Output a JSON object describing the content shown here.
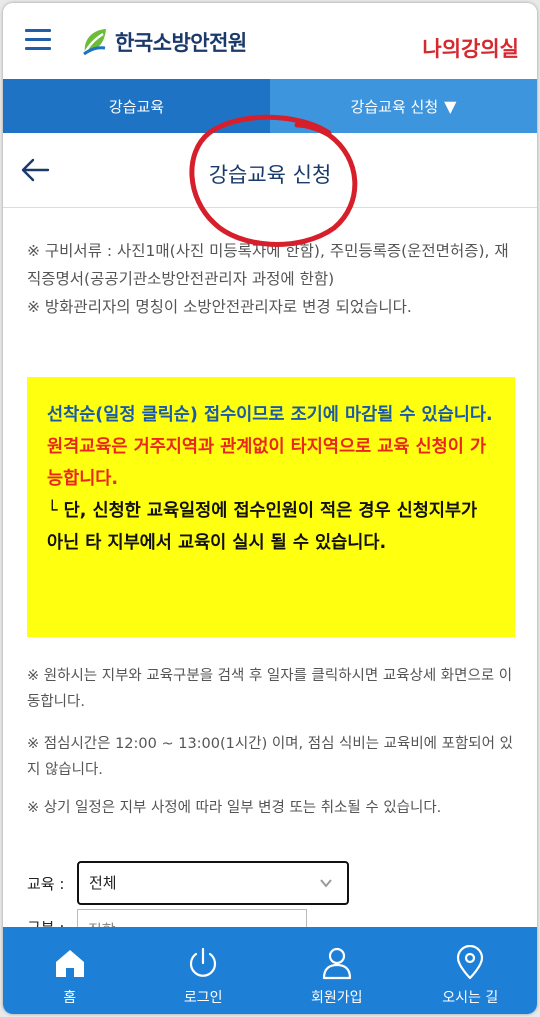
{
  "header": {
    "logo_text": "한국소방안전원",
    "my_class_label": "나의강의실"
  },
  "tabs": [
    {
      "label": "강습교육"
    },
    {
      "label": "강습교육 신청",
      "caret": "▼"
    }
  ],
  "page": {
    "title": "강습교육 신청"
  },
  "notices": {
    "documents": "※ 구비서류 : 사진1매(사진 미등록자에 한함), 주민등록증(운전면허증), 재직증명서(공공기관소방안전관리자 과정에 한함)",
    "rename": "※ 방화관리자의 명칭이 소방안전관리자로 변경 되었습니다.",
    "search_hint": "※ 원하시는 지부와 교육구분을 검색 후 일자를 클릭하시면 교육상세 화면으로 이동합니다.",
    "lunch": "※ 점심시간은 12:00 ~ 13:00(1시간) 이며, 점심 식비는 교육비에 포함되어 있지 않습니다.",
    "schedule_change": "※ 상기 일정은 지부 사정에 따라 일부 변경 또는 취소될 수 있습니다."
  },
  "highlight": {
    "line_blue": "선착순(일정 클릭순) 접수이므로 조기에 마감될 수 있습니다.",
    "line_red": "원격교육은 거주지역과 관계없이 타지역으로 교육 신청이 가능합니다.",
    "line_black": "└ 단, 신청한 교육일정에 접수인원이 적은 경우 신청지부가 아닌 타 지부에서 교육이 실시 될 수 있습니다."
  },
  "filters": {
    "education_label": "교육 :",
    "education_value": "전체",
    "category_label": "구분 :",
    "category_value": "집합"
  },
  "bottom_nav": [
    {
      "label": "홈",
      "icon": "home-icon"
    },
    {
      "label": "로그인",
      "icon": "power-icon"
    },
    {
      "label": "회원가입",
      "icon": "user-icon"
    },
    {
      "label": "오시는 길",
      "icon": "location-pin-icon"
    }
  ],
  "colors": {
    "brand_blue": "#1e73c5",
    "tab_active": "#3d95dd",
    "accent_red": "#d6282f",
    "highlight_yellow": "#ffff10",
    "nav_blue": "#1e7fd6"
  }
}
